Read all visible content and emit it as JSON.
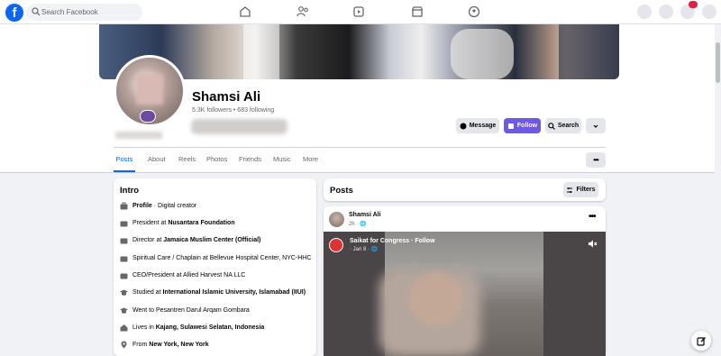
{
  "search": {
    "placeholder": "Search Facebook"
  },
  "profile": {
    "name": "Shamsi Ali",
    "stats": "5.3K followers • 683 following"
  },
  "actions": {
    "message": "Message",
    "follow": "Follow",
    "search": "Search"
  },
  "tabs": [
    "Posts",
    "About",
    "Reels",
    "Photos",
    "Friends",
    "Music",
    "More"
  ],
  "intro": {
    "title": "Intro",
    "items": [
      {
        "icon": "briefcase-icon",
        "bold": "Profile",
        "text": " · Digital creator"
      },
      {
        "icon": "briefcase-icon",
        "text": "President at ",
        "bold": "Nusantara Foundation"
      },
      {
        "icon": "briefcase-icon",
        "text": "Director at ",
        "bold": "Jamaica Muslim Center (Official)"
      },
      {
        "icon": "briefcase-icon",
        "text": "Spiritual Care / Chaplain at Bellevue Hospital Center, NYC-HHC",
        "bold": ""
      },
      {
        "icon": "briefcase-icon",
        "text": "CEO/President at Allied Harvest NA LLC",
        "bold": ""
      },
      {
        "icon": "graduation-cap-icon",
        "text": "Studied at ",
        "bold": "International Islamic University, Islamabad (IIUI)"
      },
      {
        "icon": "graduation-cap-icon",
        "text": "Went to Pesantren Darul Arqam Gombara",
        "bold": ""
      },
      {
        "icon": "home-icon",
        "text": "Lives in ",
        "bold": "Kajang, Sulawesi Selatan, Indonesia"
      },
      {
        "icon": "location-pin-icon",
        "text": "From ",
        "bold": "New York, New York"
      }
    ]
  },
  "posts": {
    "title": "Posts",
    "filters": "Filters",
    "post": {
      "author": "Shamsi Ali",
      "meta": "2h · 🌐",
      "shared_title": "Saikat for Congress · Follow",
      "shared_meta": "· Jan 8 · 🌐"
    }
  },
  "colors": {
    "accent": "#0866ff",
    "follow": "#6e58e6"
  }
}
